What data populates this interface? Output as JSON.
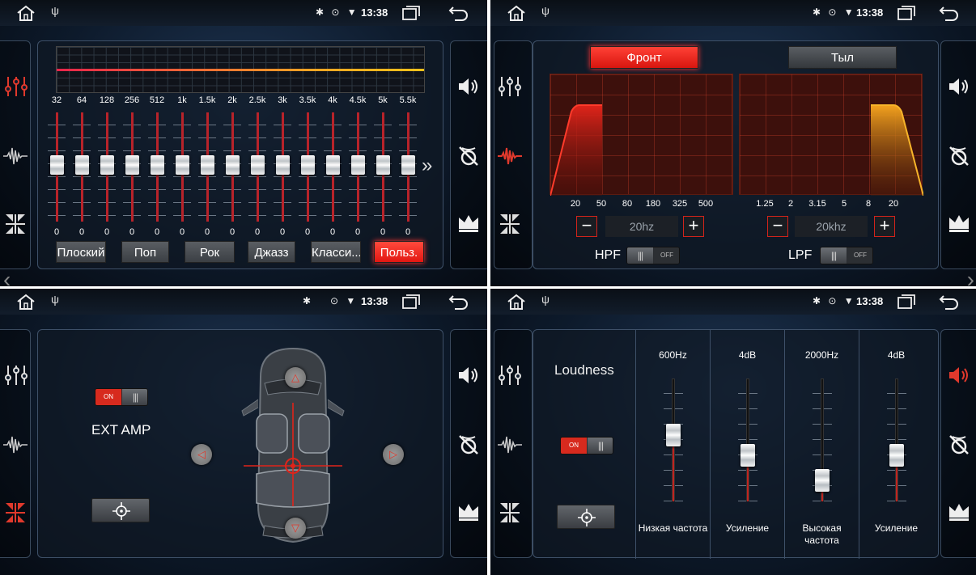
{
  "status": {
    "time": "13:38"
  },
  "equalizer": {
    "freqs": [
      "32",
      "64",
      "128",
      "256",
      "512",
      "1k",
      "1.5k",
      "2k",
      "2.5k",
      "3k",
      "3.5k",
      "4k",
      "4.5k",
      "5k",
      "5.5k"
    ],
    "values": [
      "0",
      "0",
      "0",
      "0",
      "0",
      "0",
      "0",
      "0",
      "0",
      "0",
      "0",
      "0",
      "0",
      "0",
      "0"
    ],
    "presets": [
      "Плоский",
      "Поп",
      "Рок",
      "Джазз",
      "Класси...",
      "Польз."
    ],
    "active_preset": "Польз.",
    "more_label": "»"
  },
  "crossover": {
    "tab_front": "Фронт",
    "tab_rear": "Тыл",
    "hpf_ticks": [
      "20",
      "50",
      "80",
      "180",
      "325",
      "500"
    ],
    "lpf_ticks": [
      "1.25",
      "2",
      "3.15",
      "5",
      "8",
      "20"
    ],
    "hpf_value": "20hz",
    "lpf_value": "20khz",
    "minus": "−",
    "plus": "+",
    "hpf_label": "HPF",
    "lpf_label": "LPF",
    "off": "OFF"
  },
  "amp": {
    "on": "ON",
    "label": "EXT AMP"
  },
  "loudness": {
    "title": "Loudness",
    "on": "ON",
    "col1_top": "600Hz",
    "col1_bottom": "Низкая частота",
    "col2_top": "4dB",
    "col2_bottom": "Усиление",
    "col3_top": "2000Hz",
    "col3_bottom": "Высокая частота",
    "col4_top": "4dB",
    "col4_bottom": "Усиление",
    "levels": [
      0.55,
      0.35,
      0.1,
      0.35
    ]
  },
  "colors": {
    "accent": "#e21712",
    "panel_border": "#3e5068"
  }
}
